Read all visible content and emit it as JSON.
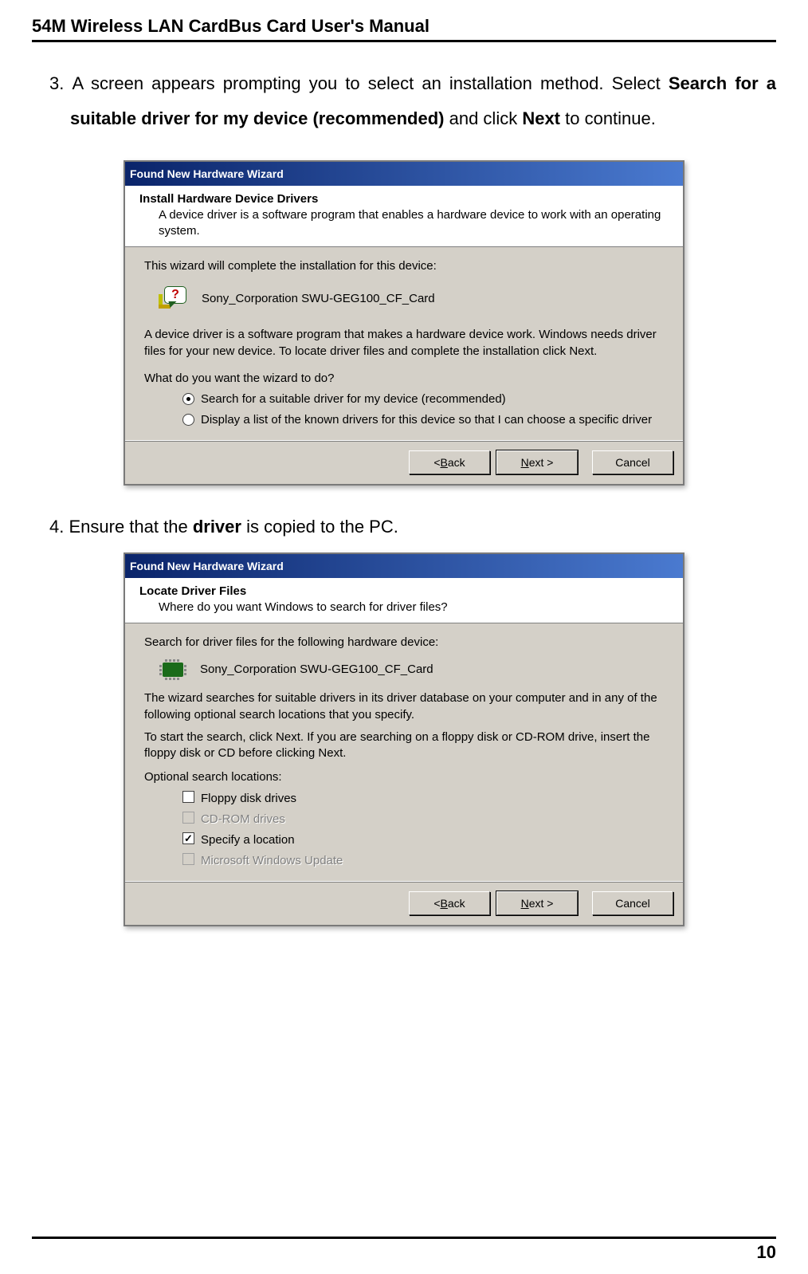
{
  "doc": {
    "header": "54M Wireless LAN CardBus Card User's Manual",
    "page_number": "10",
    "step3_num": "3.",
    "step3_text_a": "A screen appears prompting you to select an installation method. Select ",
    "step3_bold_a": "Search for a suitable driver for my device (recommended)",
    "step3_text_b": " and click ",
    "step3_bold_b": "Next",
    "step3_text_c": " to continue.",
    "step4_num": "4.",
    "step4_text_a": "Ensure that the ",
    "step4_bold_a": "driver",
    "step4_text_b": " is copied to the PC."
  },
  "wizard1": {
    "title": "Found New Hardware Wizard",
    "header_title": "Install Hardware Device Drivers",
    "header_desc": "A device driver is a software program that enables a hardware device to work with an operating system.",
    "line1": "This wizard will complete the installation for this device:",
    "device_name": "Sony_Corporation SWU-GEG100_CF_Card",
    "para2": "A device driver is a software program that makes a hardware device work. Windows needs driver files for your new device. To locate driver files and complete the installation click Next.",
    "question": "What do you want the wizard to do?",
    "opt1": "Search for a suitable driver for my device (recommended)",
    "opt2": "Display a list of the known drivers for this device so that I can choose a specific driver",
    "btn_back": "< Back",
    "btn_next": "Next >",
    "btn_cancel": "Cancel"
  },
  "wizard2": {
    "title": "Found New Hardware Wizard",
    "header_title": "Locate Driver Files",
    "header_desc": "Where do you want Windows to search for driver files?",
    "line1": "Search for driver files for the following hardware device:",
    "device_name": "Sony_Corporation SWU-GEG100_CF_Card",
    "para2": "The wizard searches for suitable drivers in its driver database on your computer and in any of the following optional search locations that you specify.",
    "para3": "To start the search, click Next. If you are searching on a floppy disk or CD-ROM drive, insert the floppy disk or CD before clicking Next.",
    "optlabel": "Optional search locations:",
    "chk1": "Floppy disk drives",
    "chk2": "CD-ROM drives",
    "chk3": "Specify a location",
    "chk4": "Microsoft Windows Update",
    "btn_back": "< Back",
    "btn_next": "Next >",
    "btn_cancel": "Cancel"
  }
}
